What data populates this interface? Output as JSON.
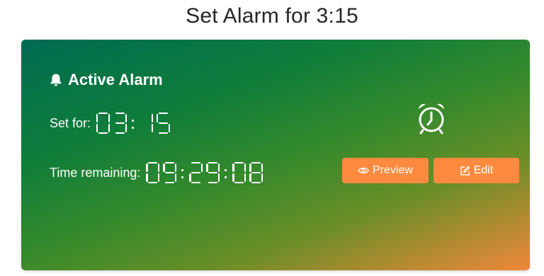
{
  "page": {
    "title": "Set Alarm for 3:15"
  },
  "card": {
    "header": "Active Alarm",
    "set_for_label": "Set for:",
    "set_for_time": "03:15",
    "remaining_label": "Time remaining:",
    "remaining_time": "09:29:08",
    "icons": {
      "header": "bell-icon",
      "status": "alarm-clock-icon",
      "preview": "eye-icon",
      "edit": "pencil-square-icon"
    }
  },
  "actions": {
    "preview_label": "Preview",
    "edit_label": "Edit"
  },
  "colors": {
    "gradient_start": "#006b52",
    "gradient_mid": "#358a2c",
    "gradient_end": "#f0873a",
    "button": "#fd8a3e",
    "text": "#ffffff"
  }
}
